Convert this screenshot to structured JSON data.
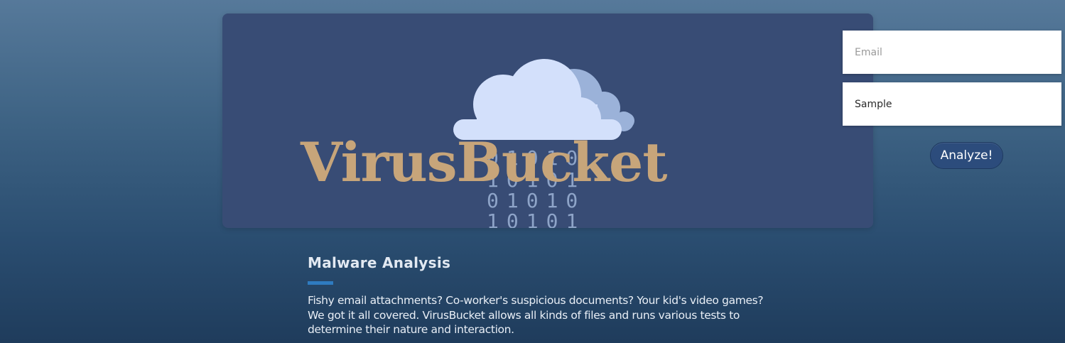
{
  "brand": {
    "logo_text": "VirusBucket",
    "binary_rows": [
      "01010",
      "10101",
      "01010",
      "10101"
    ]
  },
  "form": {
    "email_placeholder": "Email",
    "sample_label": "Sample",
    "analyze_label": "Analyze!"
  },
  "feature": {
    "title": "Malware Analysis",
    "description": "Fishy email attachments? Co-worker's suspicious documents? Your kid's video games? We got it all covered. VirusBucket allows all kinds of files and runs various tests to determine their nature and interaction."
  },
  "colors": {
    "hero_bg": "#384c75",
    "logo_gold": "#c7a57a",
    "cloud_front": "#d3e0fb",
    "cloud_back": "#9bb2d9",
    "accent_blue": "#2f7bc0",
    "button_bg": "#2c4c7c"
  },
  "icons": [
    "cloud-icon"
  ]
}
